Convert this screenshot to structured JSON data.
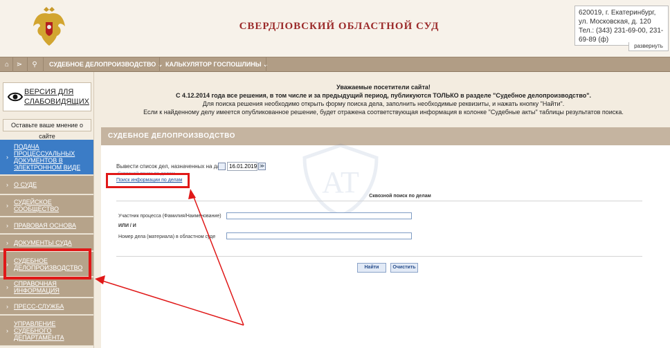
{
  "header": {
    "court_title": "СВЕРДЛОВСКИЙ ОБЛАСТНОЙ СУД",
    "contact_line1": "620019, г. Екатеринбург,",
    "contact_line2": "ул. Московская, д. 120",
    "contact_line3": "Тел.: (343) 231-69-00, 231-69-89 (ф)",
    "expand_label": "развернуть"
  },
  "nav": {
    "home_icon": "home-icon",
    "share_icon": "share-icon",
    "search_icon": "search-icon",
    "items": [
      "СУДЕБНОЕ ДЕЛОПРОИЗВОДСТВО ⌄",
      "КАЛЬКУЛЯТОР ГОСПОШЛИНЫ ⌄"
    ]
  },
  "sidebar": {
    "vision_label": "ВЕРСИЯ ДЛЯ СЛАБОВИДЯЩИХ",
    "feedback_label": "Оставьте ваше мнение о сайте",
    "menu": [
      "ПОДАЧА ПРОЦЕССУАЛЬНЫХ ДОКУМЕНТОВ В ЭЛЕКТРОННОМ ВИДЕ",
      "О СУДЕ",
      "СУДЕЙСКОЕ СООБЩЕСТВО",
      "ПРАВОВАЯ ОСНОВА",
      "ДОКУМЕНТЫ СУДА",
      "СУДЕБНОЕ ДЕЛОПРОИЗВОДСТВО",
      "СПРАВОЧНАЯ ИНФОРМАЦИЯ",
      "ПРЕСС-СЛУЖБА",
      "УПРАВЛЕНИЕ СУДЕБНОГО ДЕПАРТАМЕНТА"
    ]
  },
  "notice": {
    "line1": "Уважаемые посетители сайта!",
    "line2": "С 4.12.2014 года все решения, в том числе и за предыдущий период, публикуются ТОЛЬКО в разделе \"Судебное делопроизводство\".",
    "line3": "Для поиска решения необходимо открыть форму поиска дела, заполнить необходимые реквизиты, и нажать кнопку \"Найти\".",
    "line4": "Если к найденному делу имеется опубликованное решение, будет отражена соответствующая информация в колонке \"Судебные акты\" таблицы результатов поиска."
  },
  "panel": {
    "title": "СУДЕБНОЕ ДЕЛОПРОИЗВОДСТВО",
    "date_label": "Вывести список дел, назначенных на дату",
    "date_value": "16.01.2019",
    "link_faded": "Сквозной поиск по делам",
    "search_link": "Поиск информации по делам",
    "section_header": "Сквозной поиск по делам",
    "participant_label": "Участник процесса (Фамилия/Наименование)",
    "or_label": "ИЛИ / И",
    "case_label": "Номер дела (материала) в областном суде",
    "find_button": "Найти",
    "clear_button": "Очистить"
  },
  "colors": {
    "accent_red": "#e01818",
    "active_menu": "#3b7cc6",
    "nav_bg": "#b19d85",
    "title_red": "#9b2a2a"
  }
}
